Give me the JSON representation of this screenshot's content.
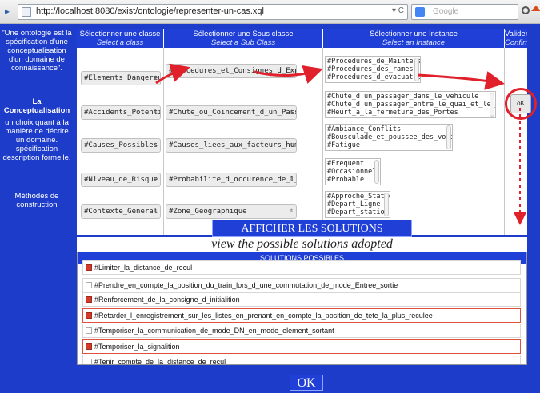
{
  "browser": {
    "url": "http://localhost:8080/exist/ontologie/representer-un-cas.xql",
    "url_controls": "▾ C",
    "search_placeholder": "Google"
  },
  "sidebar": {
    "para1": "\"Une ontologie est la spécification d'une conceptualisation d'un domaine de connaissance\".",
    "para2_title": "La Conceptualisation",
    "para2_body": "un choix quant à la manière de décrire un domaine. spécification description formelle.",
    "para3": "Méthodes de construction"
  },
  "columns": [
    {
      "title": "Sélectionner une classe",
      "subtitle": "Select a class"
    },
    {
      "title": "Sélectionner une Sous classe",
      "subtitle": "Select a Sub Class"
    },
    {
      "title": "Sélectionner une Instance",
      "subtitle": "Select an Instance"
    },
    {
      "title": "Valider",
      "subtitle": "Confirm"
    }
  ],
  "classes": [
    "#Elements_Dangereux",
    "#Accidents_Potentiels",
    "#Causes_Possibles",
    "#Niveau_de_Risque",
    "#Contexte_General"
  ],
  "subclasses": [
    "#Procedures_et_Consignes_d_Exploitation",
    "#Chute_ou_Coincement_d_un_Passager",
    "#Causes_liees_aux_facteurs_humains",
    "#Probabilite_d_occurence_de_l_accident",
    "#Zone_Geographique"
  ],
  "instances": [
    [
      "#Procedures_de_Maintenance",
      "#Procedures_des_rames",
      "#Procédures_d_evacuation"
    ],
    [
      "#Chute_d'un_passager_dans_le_vehicule",
      "#Chute_d'un_passager_entre_le_quai_et_le_vehicule",
      "#Heurt_a_la_fermeture_des_Portes"
    ],
    [
      "#Ambiance_Conflits",
      "#Bousculade_et_poussee_des_voyageurs",
      "#Fatigue"
    ],
    [
      "#Frequent",
      "#Occasionnel",
      "#Probable"
    ],
    [
      "#Approche_Station",
      "#Depart_Ligne",
      "#Depart_station"
    ]
  ],
  "ok_small": "oK",
  "afficher_label": "AFFICHER LES SOLUTIONS POSSIBLES",
  "adopted_label": "view the possible solutions adopted",
  "solutions_header": "SOLUTIONS POSSIBLES",
  "solutions": [
    {
      "label": "#Limiter_la_distance_de_recul",
      "checked": true
    },
    {
      "label": "#Prendre_en_compte_la_position_du_train_lors_d_une_commutation_de_mode_Entree_sortie",
      "checked": false
    },
    {
      "label": "#Renforcement_de_la_consigne_d_initialition",
      "checked": true
    },
    {
      "label": "#Retarder_l_enregistrement_sur_les_listes_en_prenant_en_compte_la_position_de_tete_la_plus_reculee",
      "checked": true
    },
    {
      "label": "#Temporiser_la_communication_de_mode_DN_en_mode_element_sortant",
      "checked": false
    },
    {
      "label": "#Temporiser_la_signalition",
      "checked": true
    },
    {
      "label": "#Tenir_compte_de_la_distance_de_recul",
      "checked": false
    }
  ],
  "ok_bottom": "OK",
  "colors": {
    "panel_blue": "#1d3cc9",
    "header_blue": "#1f3fd6",
    "annotation_red": "#e0202a"
  }
}
